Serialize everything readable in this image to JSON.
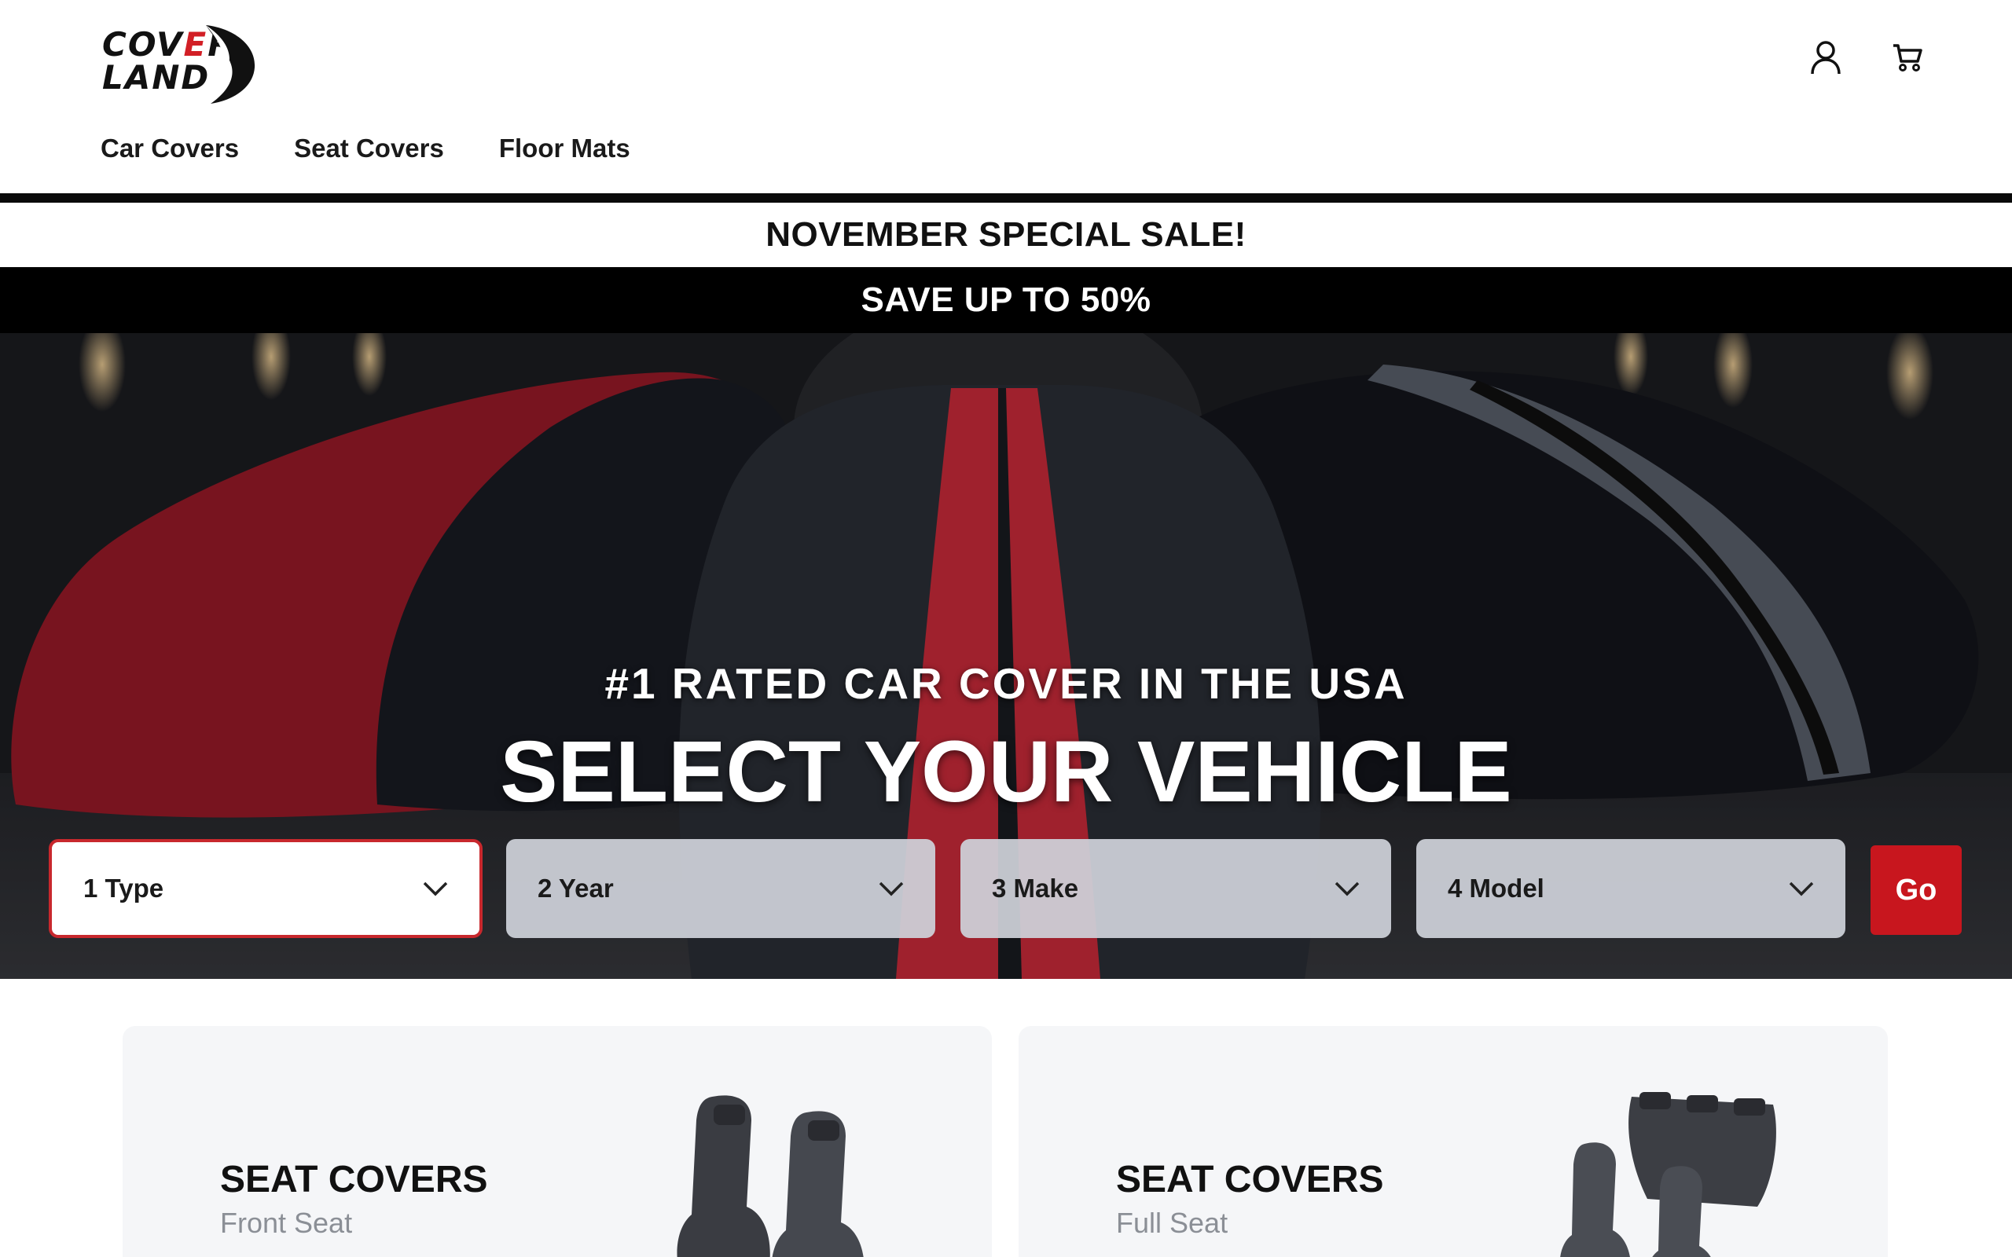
{
  "brand": {
    "logo_line1_a": "COV",
    "logo_line1_b": "E",
    "logo_line1_c": "R",
    "logo_line2": "LAND"
  },
  "header": {
    "icons": [
      "user-icon",
      "cart-icon"
    ]
  },
  "nav": {
    "items": [
      {
        "label": "Car Covers"
      },
      {
        "label": "Seat Covers"
      },
      {
        "label": "Floor Mats"
      }
    ]
  },
  "promo": {
    "headline": "NOVEMBER SPECIAL SALE!",
    "subline": "SAVE UP TO 50%"
  },
  "hero": {
    "tagline": "#1 RATED CAR COVER IN THE USA",
    "title": "SELECT YOUR VEHICLE",
    "selectors": [
      {
        "label": "1  Type"
      },
      {
        "label": "2  Year"
      },
      {
        "label": "3  Make"
      },
      {
        "label": "4  Model"
      }
    ],
    "go_label": "Go",
    "colors": {
      "accent": "#c8161e",
      "active_border": "#c8282d"
    }
  },
  "products": [
    {
      "title": "SEAT COVERS",
      "subtitle": "Front Seat"
    },
    {
      "title": "SEAT COVERS",
      "subtitle": "Full Seat"
    }
  ]
}
